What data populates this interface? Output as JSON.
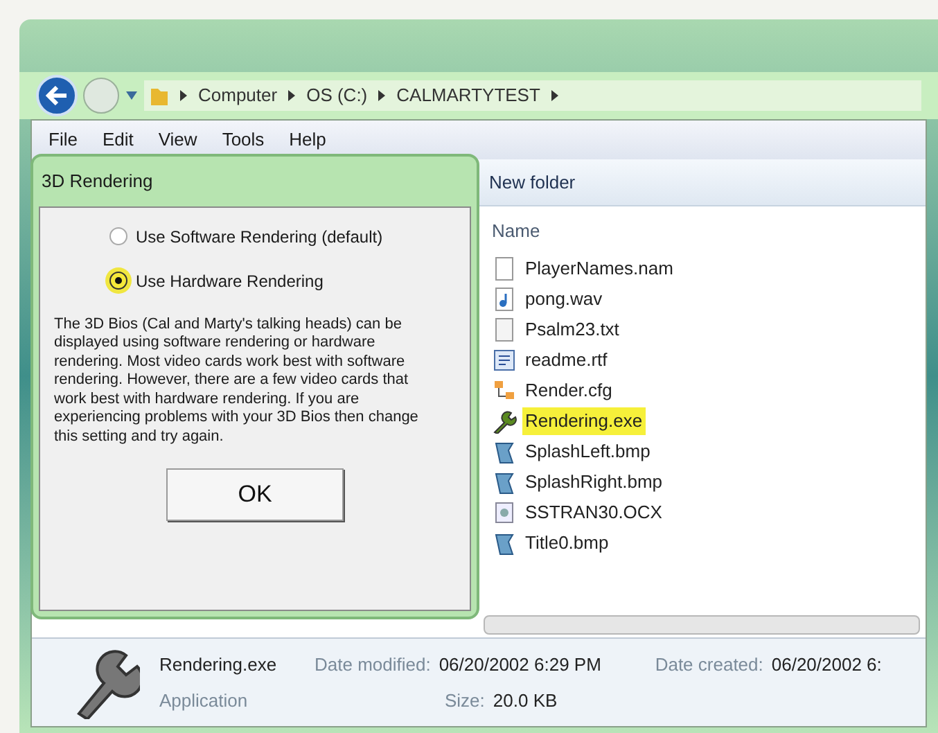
{
  "breadcrumb": [
    "Computer",
    "OS (C:)",
    "CALMARTYTEST"
  ],
  "menu": [
    "File",
    "Edit",
    "View",
    "Tools",
    "Help"
  ],
  "toolbar": {
    "new_folder": "New folder"
  },
  "dialog": {
    "title": "3D Rendering",
    "options": [
      {
        "label": "Use Software Rendering (default)",
        "selected": false
      },
      {
        "label": "Use Hardware Rendering",
        "selected": true
      }
    ],
    "description": "The 3D Bios (Cal and Marty's talking heads) can be displayed using software rendering or hardware rendering. Most video cards work best with software rendering. However, there are a few video cards that work best with hardware rendering. If you are experiencing problems with your 3D Bios then change this setting and try again.",
    "ok": "OK"
  },
  "file_list": {
    "column": "Name",
    "files": [
      {
        "name": "PlayerNames.nam",
        "kind": "blank",
        "highlighted": false
      },
      {
        "name": "pong.wav",
        "kind": "audio",
        "highlighted": false
      },
      {
        "name": "Psalm23.txt",
        "kind": "text",
        "highlighted": false
      },
      {
        "name": "readme.rtf",
        "kind": "doc",
        "highlighted": false
      },
      {
        "name": "Render.cfg",
        "kind": "config",
        "highlighted": false
      },
      {
        "name": "Rendering.exe",
        "kind": "app",
        "highlighted": true
      },
      {
        "name": "SplashLeft.bmp",
        "kind": "image",
        "highlighted": false
      },
      {
        "name": "SplashRight.bmp",
        "kind": "image",
        "highlighted": false
      },
      {
        "name": "SSTRAN30.OCX",
        "kind": "control",
        "highlighted": false
      },
      {
        "name": "Title0.bmp",
        "kind": "image",
        "highlighted": false
      }
    ]
  },
  "details": {
    "name": "Rendering.exe",
    "type": "Application",
    "modified_label": "Date modified:",
    "modified": "06/20/2002 6:29 PM",
    "size_label": "Size:",
    "size": "20.0 KB",
    "created_label": "Date created:",
    "created": "06/20/2002 6:"
  }
}
